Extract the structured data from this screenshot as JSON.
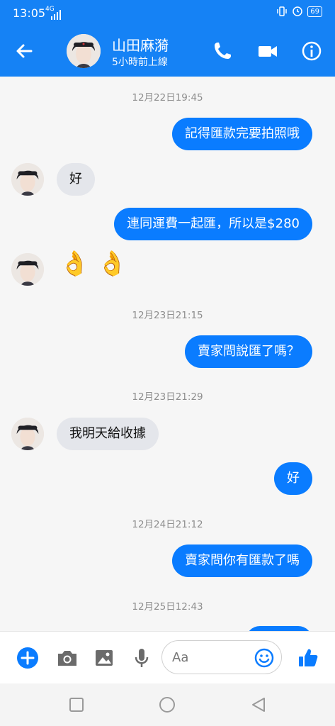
{
  "status_bar": {
    "time": "13:05",
    "network": "4G",
    "battery": "69"
  },
  "header": {
    "contact_name": "山田麻漪",
    "contact_status": "5小時前上線"
  },
  "messages": [
    {
      "type": "timestamp",
      "text": "12月22日19:45"
    },
    {
      "type": "outgoing",
      "text": "記得匯款完要拍照哦"
    },
    {
      "type": "incoming",
      "text": "好"
    },
    {
      "type": "outgoing",
      "text": "連同運費一起匯，所以是$280"
    },
    {
      "type": "incoming-emoji",
      "text": "👌 👌"
    },
    {
      "type": "timestamp",
      "text": "12月23日21:15"
    },
    {
      "type": "outgoing",
      "text": "賣家問說匯了嗎？"
    },
    {
      "type": "timestamp",
      "text": "12月23日21:29"
    },
    {
      "type": "incoming",
      "text": "我明天給收據"
    },
    {
      "type": "outgoing",
      "text": "好"
    },
    {
      "type": "timestamp",
      "text": "12月24日21:12"
    },
    {
      "type": "outgoing",
      "text": "賣家問你有匯款了嗎"
    },
    {
      "type": "timestamp",
      "text": "12月25日12:43"
    }
  ],
  "composer": {
    "placeholder": "Aa"
  },
  "icons": {
    "back": "arrow-left-icon",
    "call": "phone-icon",
    "video": "video-camera-icon",
    "info": "info-icon",
    "add": "plus-icon",
    "camera": "camera-icon",
    "gallery": "image-icon",
    "mic": "microphone-icon",
    "emoji": "smiley-icon",
    "like": "thumbs-up-icon"
  },
  "colors": {
    "brand": "#1582f5",
    "outgoing_bubble": "#0a7cff",
    "incoming_bubble": "#e4e6eb"
  }
}
